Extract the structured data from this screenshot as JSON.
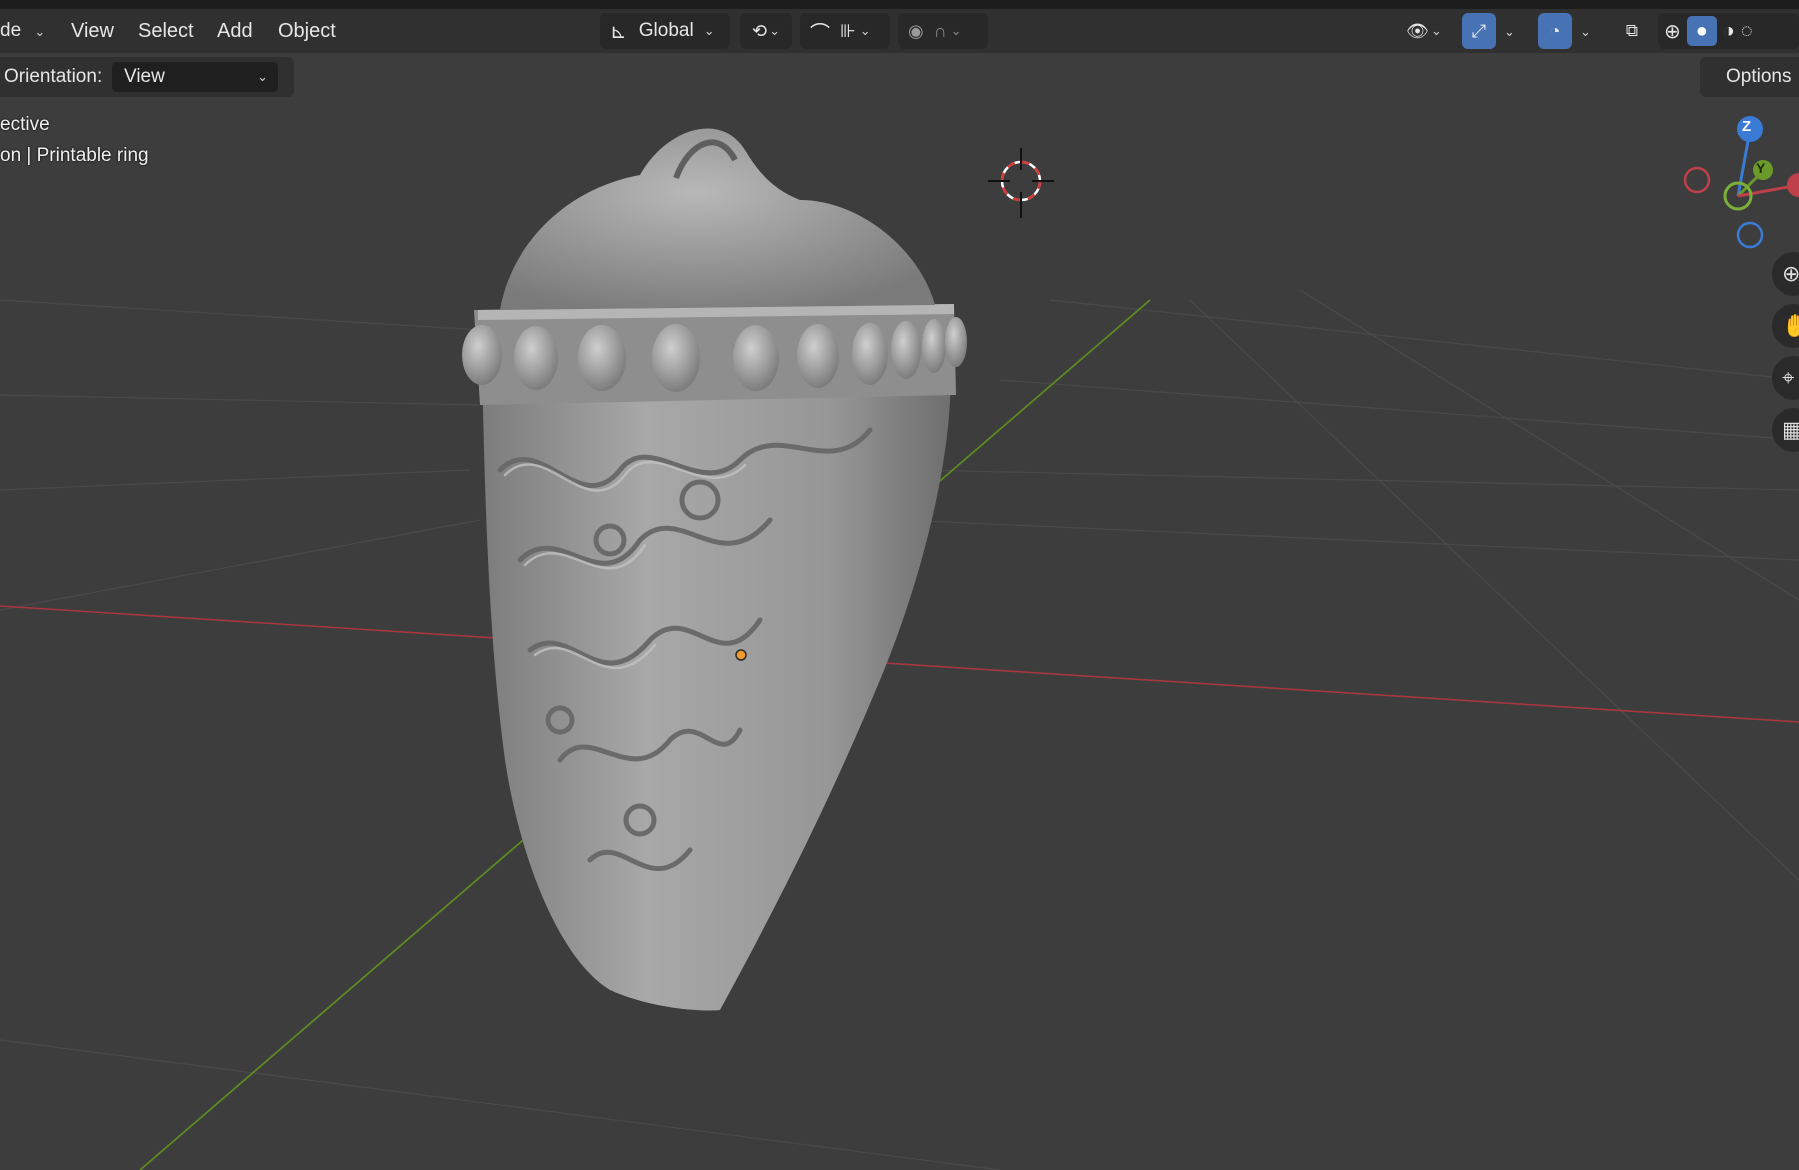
{
  "header": {
    "mode_fragment": "de",
    "menus": [
      "View",
      "Select",
      "Add",
      "Object"
    ],
    "transform_orientation": "Global"
  },
  "tool_settings": {
    "orientation_label": "Orientation:",
    "orientation_value": "View",
    "options_label": "Options"
  },
  "viewport": {
    "view_name_fragment": "ective",
    "object_info_fragment": "on | Printable ring"
  },
  "gizmo": {
    "z_label": "Z",
    "y_label": "Y"
  },
  "colors": {
    "accent": "#4772b3",
    "x_axis": "#c0404a",
    "y_axis": "#6a9a2a",
    "z_axis": "#3a7bd5"
  }
}
